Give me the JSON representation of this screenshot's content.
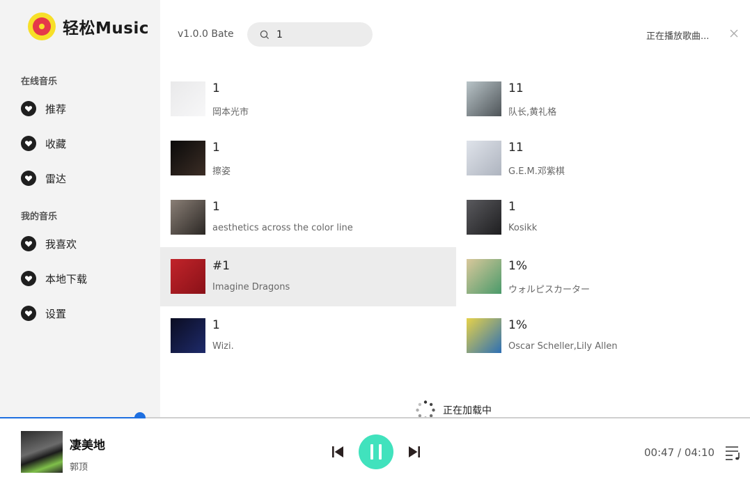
{
  "app": {
    "name": "轻松Music",
    "version": "v1.0.0 Bate"
  },
  "search": {
    "value": "1"
  },
  "header": {
    "now_playing": "正在播放歌曲..."
  },
  "sidebar": {
    "sections": [
      {
        "title": "在线音乐",
        "items": [
          {
            "label": "推荐"
          },
          {
            "label": "收藏"
          },
          {
            "label": "雷达"
          }
        ]
      },
      {
        "title": "我的音乐",
        "items": [
          {
            "label": "我喜欢"
          },
          {
            "label": "本地下载"
          },
          {
            "label": "设置"
          }
        ]
      }
    ]
  },
  "results": [
    {
      "title": "1",
      "artist": "岡本光市",
      "cover_colors": [
        "#e9e9ea",
        "#f7f7f8"
      ]
    },
    {
      "title": "11",
      "artist": "队长,黄礼格",
      "cover_colors": [
        "#b9c4c8",
        "#4e5458"
      ]
    },
    {
      "title": "1",
      "artist": "擦姿",
      "cover_colors": [
        "#0a0a0a",
        "#3b2d25"
      ]
    },
    {
      "title": "11",
      "artist": "G.E.M.邓紫棋",
      "cover_colors": [
        "#dfe3ea",
        "#aeb4bf"
      ]
    },
    {
      "title": "1",
      "artist": "aesthetics across the color line",
      "cover_colors": [
        "#8a7f76",
        "#2b2724"
      ]
    },
    {
      "title": "1",
      "artist": "Kosikk",
      "cover_colors": [
        "#5a5a5e",
        "#1e1e20"
      ]
    },
    {
      "title": "#1",
      "artist": "Imagine Dragons",
      "cover_colors": [
        "#c1242a",
        "#8a1118"
      ],
      "highlighted": true
    },
    {
      "title": "1%",
      "artist": "ウォルピスカーター",
      "cover_colors": [
        "#d9c89b",
        "#4a9a6a"
      ]
    },
    {
      "title": "1",
      "artist": "Wizi.",
      "cover_colors": [
        "#0b0d22",
        "#1e2a6a"
      ]
    },
    {
      "title": "1%",
      "artist": "Oscar Scheller,Lily Allen",
      "cover_colors": [
        "#e6d24a",
        "#2d6fb4"
      ]
    }
  ],
  "loading": {
    "text": "正在加载中"
  },
  "player": {
    "title": "凄美地",
    "artist": "郭顶",
    "current_time": "00:47",
    "total_time": "04:10",
    "progress": 0.187
  },
  "colors": {
    "accent": "#1e6fe0",
    "play_button": "#41e2bd",
    "sidebar_bg": "#f3f3f3"
  },
  "icons": {
    "menu_item": "heart-icon",
    "search": "search-icon",
    "close": "close-icon",
    "prev": "skip-previous-icon",
    "pause": "pause-icon",
    "next": "skip-next-icon",
    "playlist": "playlist-icon",
    "loading": "spinner-icon"
  }
}
